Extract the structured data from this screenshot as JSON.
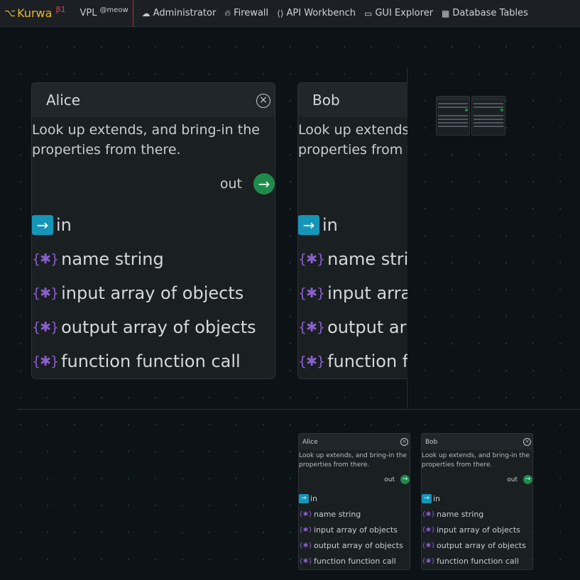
{
  "topbar": {
    "brand": "Kurwa",
    "brand_version": "β1",
    "vpl": "VPL",
    "vpl_user": "@meow",
    "nav": [
      {
        "label": "Administrator",
        "icon": "cloud-user-icon"
      },
      {
        "label": "Firewall",
        "icon": "flame-icon"
      },
      {
        "label": "API Workbench",
        "icon": "code-icon"
      },
      {
        "label": "GUI Explorer",
        "icon": "window-icon"
      },
      {
        "label": "Database Tables",
        "icon": "table-icon"
      }
    ]
  },
  "nodes": [
    {
      "title": "Alice",
      "description": "Look up extends, and bring-in the\nproperties from there.",
      "out_label": "out",
      "ports": {
        "in": "in",
        "p1": "name string",
        "p2": "input array of objects",
        "p3": "output array of objects",
        "p4": "function function call"
      }
    },
    {
      "title": "Bob",
      "description": "Look up extends, and bring-in the\nproperties from there.",
      "out_label": "out",
      "ports": {
        "in": "in",
        "p1": "name string",
        "p2": "input array of objects",
        "p3": "output array of objects",
        "p4": "function function call"
      }
    }
  ],
  "icons": {
    "input": "→",
    "output": "→",
    "brace": "{✱}",
    "close": "✕"
  },
  "colors": {
    "brand": "#e8b923",
    "version": "#e04848",
    "output": "#1f8a4c",
    "input": "#1596b8",
    "brace": "#8a5fcf"
  }
}
